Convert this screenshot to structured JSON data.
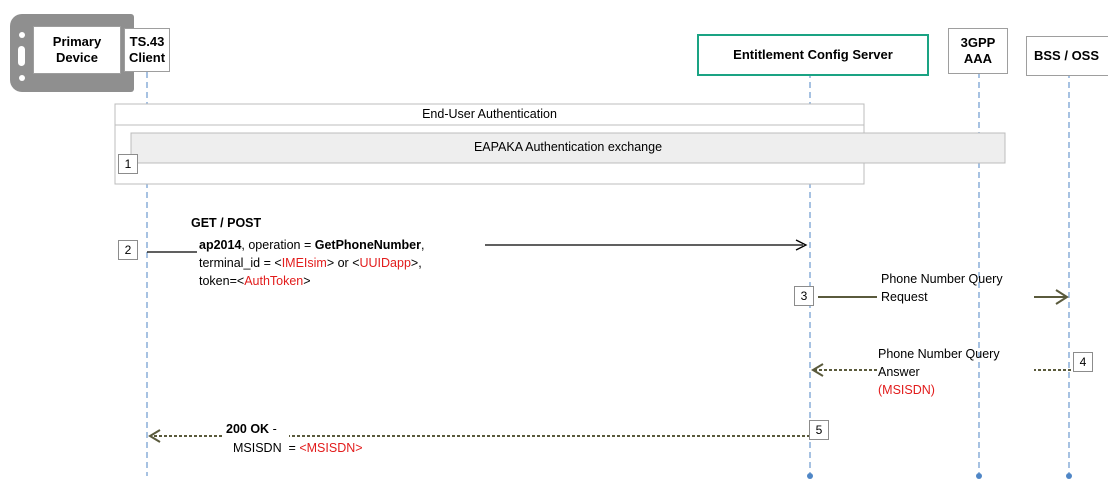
{
  "participants": {
    "primary_device": "Primary\nDevice",
    "ts43_client": "TS.43\nClient",
    "ecs": "Entitlement Config Server",
    "aaa": "3GPP\nAAA",
    "bss": "BSS / OSS"
  },
  "frames": {
    "end_user_auth": "End-User Authentication",
    "eapaka": "EAPAKA Authentication exchange"
  },
  "steps": {
    "s1": "1",
    "s2": "2",
    "s3": "3",
    "s4": "4",
    "s5": "5"
  },
  "msg2": {
    "method": "GET / POST",
    "app": "ap2014",
    "op_prefix": ", operation = ",
    "op_value": "GetPhoneNumber",
    "op_suffix": ",",
    "terminal_prefix": "terminal_id = <",
    "imei": "IMEIsim",
    "terminal_mid": "> or <",
    "uuid": "UUIDapp",
    "terminal_suffix": ">,",
    "token_prefix": "token=<",
    "token": "AuthToken",
    "token_suffix": ">"
  },
  "msg3": {
    "line1": "Phone Number Query",
    "line2": "Request"
  },
  "msg4": {
    "line1": "Phone Number Query",
    "line2": "Answer",
    "line3": "(MSISDN)"
  },
  "msg5": {
    "status": "200 OK",
    "status_suffix": " -",
    "field": "MSISDN  = ",
    "value": "<MSISDN>"
  },
  "colors": {
    "ecs_border": "#1aa383",
    "lifeline": "#4f86c6",
    "red_text": "#e21c1c",
    "arrow_dark": "#5a5a3c",
    "device_grey": "#8f8f8f"
  }
}
